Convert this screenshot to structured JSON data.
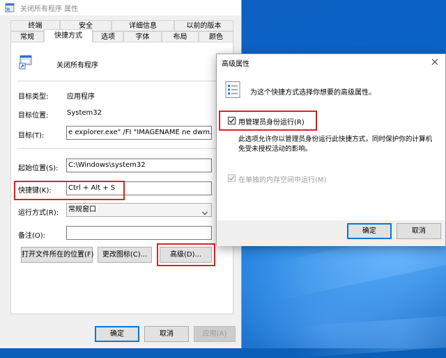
{
  "window": {
    "title": "关闭所有程序 属性"
  },
  "tabs_row1": [
    {
      "label": "终端"
    },
    {
      "label": "安全"
    },
    {
      "label": "详细信息"
    },
    {
      "label": "以前的版本"
    }
  ],
  "tabs_row2": [
    {
      "label": "常规"
    },
    {
      "label": "快捷方式"
    },
    {
      "label": "选项"
    },
    {
      "label": "字体"
    },
    {
      "label": "布局"
    },
    {
      "label": "颜色"
    }
  ],
  "shortcut": {
    "name": "关闭所有程序",
    "target_type_label": "目标类型:",
    "target_type_value": "应用程序",
    "target_location_label": "目标位置:",
    "target_location_value": "System32",
    "target_label": "目标(T):",
    "target_value": "e explorer.exe\" /FI \"IMAGENAME ne dwm.exe\"",
    "start_in_label": "起始位置(S):",
    "start_in_value": "C:\\Windows\\system32",
    "hotkey_label": "快捷键(K):",
    "hotkey_value": "Ctrl + Alt + S",
    "run_label": "运行方式(R):",
    "run_value": "常规窗口",
    "comment_label": "备注(O):",
    "comment_value": "",
    "open_location_button": "打开文件所在的位置(F)",
    "change_icon_button": "更改图标(C)...",
    "advanced_button": "高级(D)..."
  },
  "footer": {
    "ok": "确定",
    "cancel": "取消",
    "apply": "应用(A)"
  },
  "advanced_dialog": {
    "title": "高级属性",
    "description": "为这个快捷方式选择你想要的高级属性。",
    "run_as_admin_label": "用管理员身份运行(R)",
    "run_as_admin_checked": true,
    "run_as_admin_note_line1": "此选项允许你以管理员身份运行此快捷方式，同时保护你的计算机",
    "run_as_admin_note_line2": "免受未授权活动的影响。",
    "separate_memory_label": "在单独的内存空间中运行(M)",
    "separate_memory_checked": true,
    "separate_memory_enabled": false,
    "ok": "确定",
    "cancel": "取消"
  },
  "colors": {
    "highlight_box": "#e02020",
    "accent": "#0078d7",
    "desktop": "#0b63c6"
  }
}
